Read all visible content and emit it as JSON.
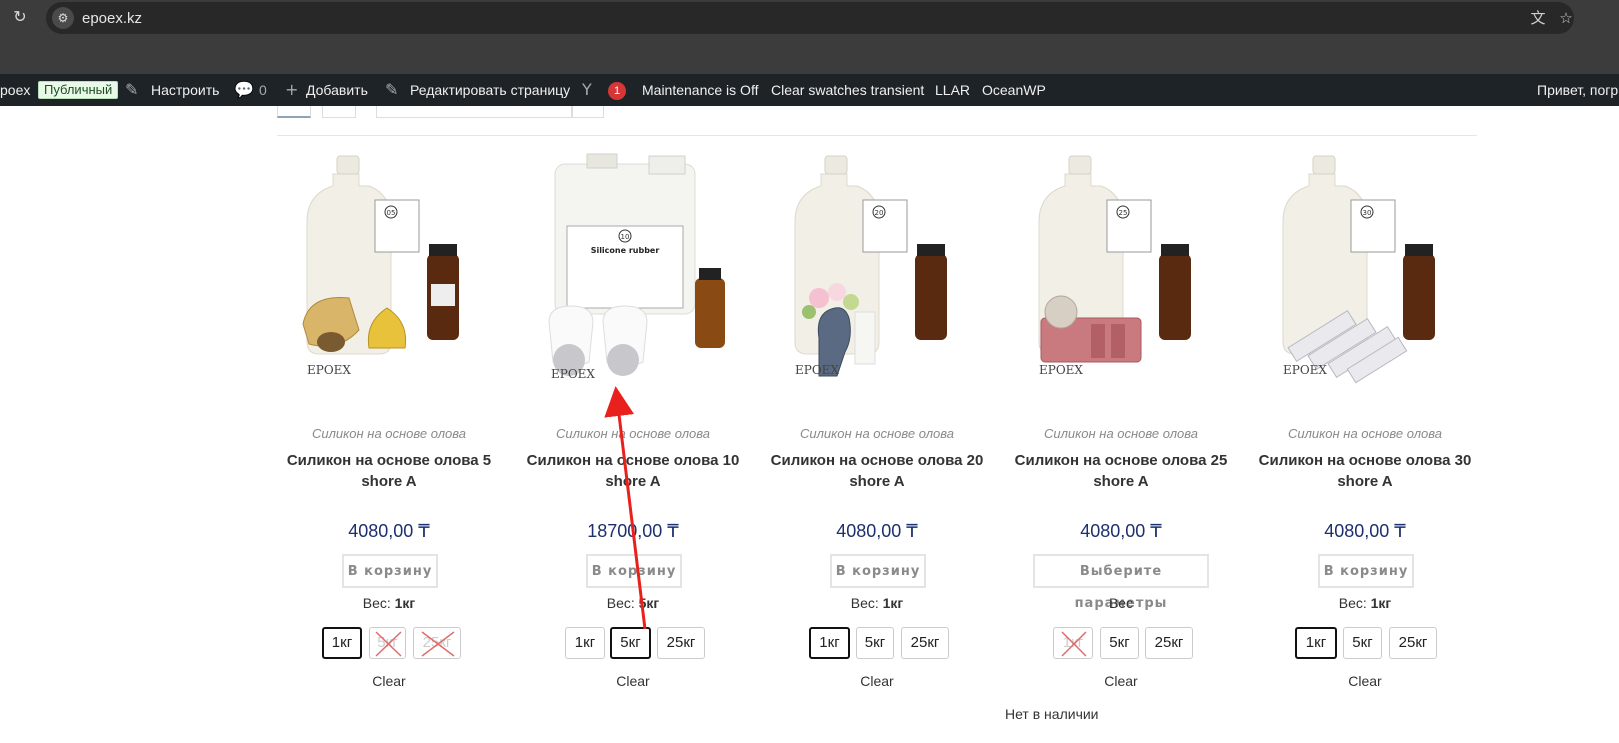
{
  "browser": {
    "url": "epoex.kz",
    "icons": [
      "reload-icon",
      "site-settings-icon",
      "translate-icon",
      "star-icon"
    ]
  },
  "adminbar": {
    "site": "poex",
    "public_badge": "Публичный",
    "customize": "Настроить",
    "comments_count": "0",
    "add_new": "Добавить",
    "edit_page": "Редактировать страницу",
    "notif_count": "1",
    "maintenance": "Maintenance is Off",
    "clear_swatches": "Clear swatches transient",
    "llar": "LLAR",
    "oceanwp": "OceanWP",
    "greeting": "Привет, погр"
  },
  "products": [
    {
      "category": "Силикон на основе олова",
      "title": "Силикон на основе олова 5 shore A",
      "price": "4080,00 ₸",
      "button": "В корзину",
      "weight_label": "Вес:",
      "weight_value": "1кг",
      "swatches": [
        {
          "label": "1кг",
          "state": "selected"
        },
        {
          "label": "5кг",
          "state": "disabled"
        },
        {
          "label": "25кг",
          "state": "disabled"
        }
      ],
      "clear": "Clear",
      "badge": "05"
    },
    {
      "category": "Силикон на основе олова",
      "title": "Силикон на основе олова 10 shore A",
      "price": "18700,00 ₸",
      "button": "В корзину",
      "weight_label": "Вес:",
      "weight_value": "5кг",
      "swatches": [
        {
          "label": "1кг",
          "state": "normal"
        },
        {
          "label": "5кг",
          "state": "selected"
        },
        {
          "label": "25кг",
          "state": "normal"
        }
      ],
      "clear": "Clear",
      "badge": "10",
      "jug_title": "Silicone rubber"
    },
    {
      "category": "Силикон на основе олова",
      "title": "Силикон на основе олова 20 shore A",
      "price": "4080,00 ₸",
      "button": "В корзину",
      "weight_label": "Вес:",
      "weight_value": "1кг",
      "swatches": [
        {
          "label": "1кг",
          "state": "selected"
        },
        {
          "label": "5кг",
          "state": "normal"
        },
        {
          "label": "25кг",
          "state": "normal"
        }
      ],
      "clear": "Clear",
      "badge": "20"
    },
    {
      "category": "Силикон на основе олова",
      "title": "Силикон на основе олова 25 shore A",
      "price": "4080,00 ₸",
      "button": "Выберите параметры",
      "weight_label": "Вес",
      "weight_value": "",
      "swatches": [
        {
          "label": "1кг",
          "state": "disabled"
        },
        {
          "label": "5кг",
          "state": "normal"
        },
        {
          "label": "25кг",
          "state": "normal"
        }
      ],
      "clear": "Clear",
      "badge": "25",
      "stock_note": "Нет в наличии"
    },
    {
      "category": "Силикон на основе олова",
      "title": "Силикон на основе олова 30 shore A",
      "price": "4080,00 ₸",
      "button": "В корзину",
      "weight_label": "Вес:",
      "weight_value": "1кг",
      "swatches": [
        {
          "label": "1кг",
          "state": "selected"
        },
        {
          "label": "5кг",
          "state": "normal"
        },
        {
          "label": "25кг",
          "state": "normal"
        }
      ],
      "clear": "Clear",
      "badge": "30"
    }
  ],
  "watermark": "EPOEX",
  "annotation": {
    "color": "#e8211d"
  }
}
